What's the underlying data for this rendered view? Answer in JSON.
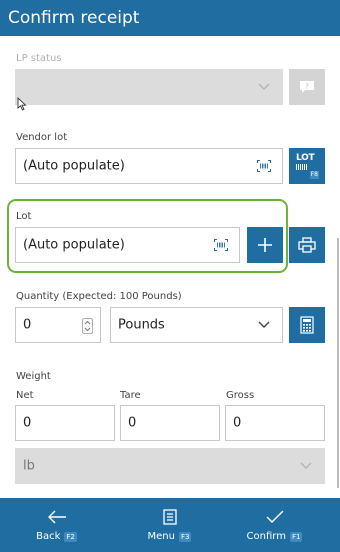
{
  "header": {
    "title": "Confirm receipt"
  },
  "lp_status": {
    "label": "LP status",
    "value": "",
    "help_icon": "question-bubble-icon"
  },
  "vendor_lot": {
    "label": "Vendor lot",
    "value": "(Auto populate)",
    "lot_button_text": "LOT",
    "lot_button_key": "F8"
  },
  "lot": {
    "label": "Lot",
    "value": "(Auto populate)"
  },
  "quantity": {
    "label": "Quantity (Expected: 100 Pounds)",
    "value": "0",
    "unit": "Pounds"
  },
  "weight": {
    "label": "Weight",
    "net_label": "Net",
    "net_value": "0",
    "tare_label": "Tare",
    "tare_value": "0",
    "gross_label": "Gross",
    "gross_value": "0",
    "unit": "lb"
  },
  "footer": {
    "back_label": "Back",
    "back_key": "F2",
    "menu_label": "Menu",
    "menu_key": "F3",
    "confirm_label": "Confirm",
    "confirm_key": "F1"
  },
  "colors": {
    "accent": "#1f6da1",
    "highlight": "#6bb33c",
    "disabled": "#dcdcdc"
  }
}
